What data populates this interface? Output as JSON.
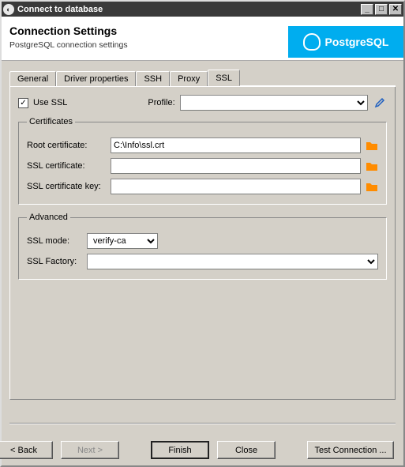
{
  "window": {
    "title": "Connect to database"
  },
  "header": {
    "title": "Connection Settings",
    "subtitle": "PostgreSQL connection settings",
    "logo_text": "PostgreSQL"
  },
  "tabs": {
    "general": "General",
    "driver": "Driver properties",
    "ssh": "SSH",
    "proxy": "Proxy",
    "ssl": "SSL"
  },
  "ssl": {
    "use_ssl_label": "Use SSL",
    "use_ssl_checked": "✓",
    "profile_label": "Profile:",
    "profile_value": ""
  },
  "certificates": {
    "legend": "Certificates",
    "root_label": "Root certificate:",
    "root_value": "C:\\Info\\ssl.crt",
    "cert_label": "SSL certificate:",
    "cert_value": "",
    "key_label": "SSL certificate key:",
    "key_value": ""
  },
  "advanced": {
    "legend": "Advanced",
    "mode_label": "SSL mode:",
    "mode_value": "verify-ca",
    "factory_label": "SSL Factory:",
    "factory_value": ""
  },
  "buttons": {
    "back": "< Back",
    "next": "Next >",
    "finish": "Finish",
    "close": "Close",
    "test": "Test Connection ..."
  }
}
